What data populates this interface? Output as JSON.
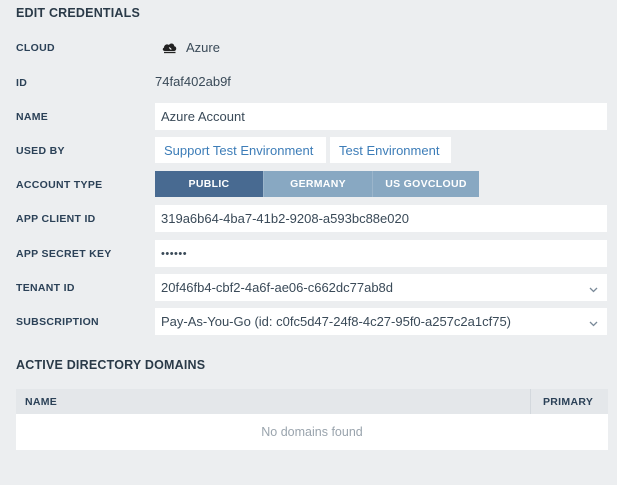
{
  "title": "EDIT CREDENTIALS",
  "fields": {
    "cloud": {
      "label": "CLOUD",
      "value": "Azure"
    },
    "id": {
      "label": "ID",
      "value": "74faf402ab9f"
    },
    "name": {
      "label": "NAME",
      "value": "Azure Account"
    },
    "used_by": {
      "label": "USED BY",
      "items": [
        "Support Test Environment",
        "Test Environment"
      ]
    },
    "account_type": {
      "label": "ACCOUNT TYPE",
      "options": [
        "PUBLIC",
        "GERMANY",
        "US GOVCLOUD"
      ],
      "selected": "PUBLIC"
    },
    "app_client_id": {
      "label": "APP CLIENT ID",
      "value": "319a6b64-4ba7-41b2-9208-a593bc88e020"
    },
    "app_secret_key": {
      "label": "APP SECRET KEY",
      "value": "••••••"
    },
    "tenant_id": {
      "label": "TENANT ID",
      "value": "20f46fb4-cbf2-4a6f-ae06-c662dc77ab8d"
    },
    "subscription": {
      "label": "SUBSCRIPTION",
      "value": "Pay-As-You-Go (id: c0fc5d47-24f8-4c27-95f0-a257c2a1cf75)"
    }
  },
  "domains": {
    "title": "ACTIVE DIRECTORY DOMAINS",
    "columns": [
      "NAME",
      "PRIMARY"
    ],
    "empty_text": "No domains found"
  },
  "icons": {
    "cloud": "cloud-icon",
    "dropdown": "chevron-down-icon"
  },
  "colors": {
    "segment_selected": "#486a91",
    "segment_unselected": "#88a8c2",
    "link": "#3d7db8",
    "background": "#eceef0"
  }
}
